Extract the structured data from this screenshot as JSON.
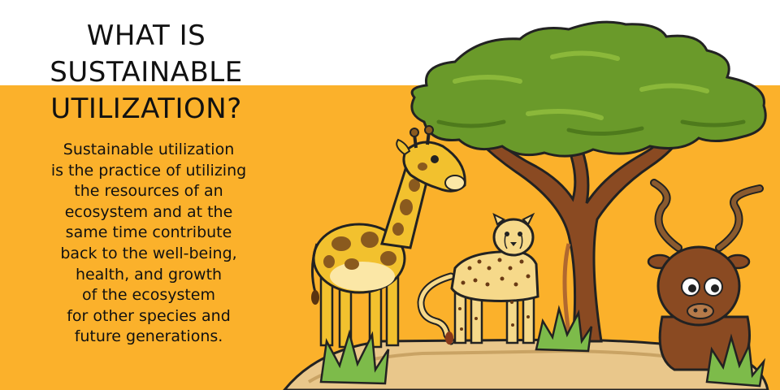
{
  "title": {
    "lines": [
      "WHAT IS",
      "SUSTAINABLE",
      "UTILIZATION?"
    ]
  },
  "body": {
    "lines": [
      "Sustainable utilization",
      "is the practice of utilizing",
      "the resources of an",
      "ecosystem and at the",
      "same time contribute",
      "back to the well-being,",
      "health, and growth",
      "of the ecosystem",
      "for other species and",
      "future generations."
    ]
  },
  "colors": {
    "background_top": "#ffffff",
    "background_band": "#fbb12b",
    "text": "#111111",
    "foliage": "#6a9a2a",
    "trunk": "#8a4a22",
    "giraffe": "#f2c12e",
    "giraffe_spots": "#8a5a1e",
    "cheetah": "#f6d98a",
    "kudu": "#8a4a22",
    "ground": "#e9c78b"
  },
  "illustration": {
    "elements": [
      "acacia-tree",
      "giraffe",
      "cheetah",
      "kudu",
      "grass-tufts",
      "ground-mound"
    ]
  }
}
